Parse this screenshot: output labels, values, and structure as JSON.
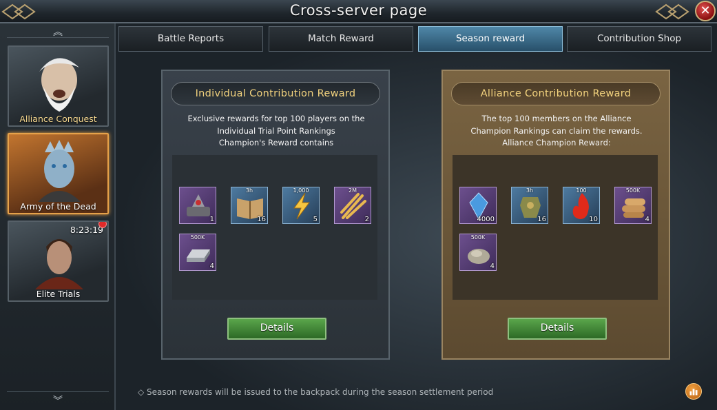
{
  "header": {
    "title": "Cross-server page",
    "close_icon": "close-icon"
  },
  "sidebar": {
    "items": [
      {
        "label": "Alliance Conquest"
      },
      {
        "label": "Army of the Dead"
      },
      {
        "label": "Elite Trials",
        "timer": "8:23:19"
      }
    ]
  },
  "tabs": [
    {
      "label": "Battle Reports"
    },
    {
      "label": "Match Reward"
    },
    {
      "label": "Season reward",
      "active": true
    },
    {
      "label": "Contribution Shop"
    }
  ],
  "individual": {
    "title": "Individual Contribution Reward",
    "desc": [
      "Exclusive rewards for top 100 players on the",
      "Individual Trial Point Rankings",
      "Champion's Reward contains"
    ],
    "items": [
      {
        "icon": "relic-icon",
        "top": "",
        "qty": "1"
      },
      {
        "icon": "book-icon",
        "top": "3h",
        "qty": "16"
      },
      {
        "icon": "lightning-icon",
        "top": "1,000",
        "qty": "5"
      },
      {
        "icon": "wheat-icon",
        "top": "2M",
        "qty": "2"
      },
      {
        "icon": "iron-ingot-icon",
        "top": "500K",
        "qty": "4"
      }
    ],
    "button": "Details"
  },
  "alliance": {
    "title": "Alliance Contribution Reward",
    "desc": [
      "The top 100 members on the Alliance",
      "Champion Rankings can claim the rewards.",
      "Alliance Champion Reward:"
    ],
    "items": [
      {
        "icon": "crystal-icon",
        "top": "",
        "qty": "4000"
      },
      {
        "icon": "armor-icon",
        "top": "3h",
        "qty": "16"
      },
      {
        "icon": "flame-icon",
        "top": "100",
        "qty": "10"
      },
      {
        "icon": "wood-icon",
        "top": "500K",
        "qty": "4"
      },
      {
        "icon": "stone-icon",
        "top": "500K",
        "qty": "4"
      }
    ],
    "button": "Details"
  },
  "footer": {
    "note": "◇  Season rewards will be issued to the backpack during the season settlement period"
  }
}
